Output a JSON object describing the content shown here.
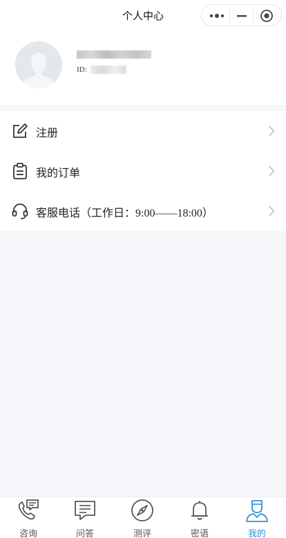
{
  "header": {
    "title": "个人中心"
  },
  "capsule": {
    "more_icon": "more-dots-icon",
    "minus_icon": "minimize-icon",
    "close_icon": "target-close-icon"
  },
  "profile": {
    "id_label": "ID:",
    "avatar_icon": "default-avatar-icon"
  },
  "menu": {
    "items": [
      {
        "label": "注册",
        "icon": "edit-icon"
      },
      {
        "label": "我的订单",
        "icon": "clipboard-icon"
      },
      {
        "label": "客服电话（工作日：9:00——18:00）",
        "icon": "headset-icon"
      }
    ]
  },
  "tabbar": {
    "active_color": "#2f8fd6",
    "items": [
      {
        "label": "咨询",
        "icon": "phone-chat-icon"
      },
      {
        "label": "问答",
        "icon": "chat-bubble-icon"
      },
      {
        "label": "测评",
        "icon": "compass-icon"
      },
      {
        "label": "密语",
        "icon": "bell-icon"
      },
      {
        "label": "我的",
        "icon": "user-icon",
        "active": true
      }
    ]
  }
}
